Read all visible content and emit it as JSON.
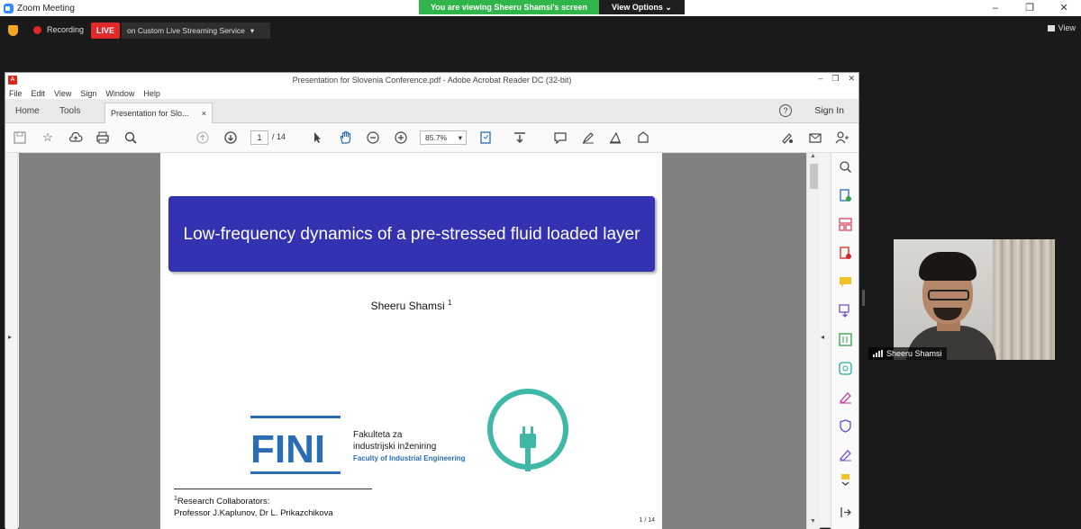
{
  "zoom": {
    "window_title": "Zoom Meeting",
    "viewing_banner": "You are viewing Sheeru Shamsi's screen",
    "view_options": "View Options ⌄",
    "recording_label": "Recording",
    "live_badge": "LIVE",
    "stream_target": "on Custom Live Streaming Service",
    "stream_caret": "▾",
    "view_label": "View",
    "win_min": "–",
    "win_max": "❐",
    "win_close": "✕",
    "participant_name": "Sheeru Shamsi"
  },
  "acrobat": {
    "window_title": "Presentation for Slovenia Conference.pdf - Adobe Acrobat Reader DC (32-bit)",
    "win_min": "–",
    "win_max": "❐",
    "win_close": "✕",
    "menu": [
      "File",
      "Edit",
      "View",
      "Sign",
      "Window",
      "Help"
    ],
    "tabs": {
      "home": "Home",
      "tools": "Tools",
      "document": "Presentation for Slo...",
      "close": "×"
    },
    "help": "?",
    "sign_in": "Sign In",
    "toolbar": {
      "page_current": "1",
      "page_total": "/ 14",
      "zoom": "85.7%",
      "zoom_caret": "▾"
    }
  },
  "slide": {
    "title": "Low-frequency dynamics of a pre-stressed fluid loaded layer",
    "author": "Sheeru Shamsi",
    "author_sup": "1",
    "logo_line1": "Fakulteta za",
    "logo_line2": "industrijski inženiring",
    "logo_line3": "Faculty of Industrial Engineering",
    "logo_word": "FINI",
    "footnote_line1": "Research Collaborators:",
    "footnote_sup": "1",
    "footnote_line2": "Professor J.Kaplunov, Dr L. Prikazchikova",
    "page_num": "1 / 14"
  },
  "colors": {
    "banner_green": "#2fb54a",
    "live_red": "#e02828",
    "slide_blue": "#3333b2",
    "logo_teal": "#3fb8a7",
    "logo_blue": "#2a6db5"
  }
}
